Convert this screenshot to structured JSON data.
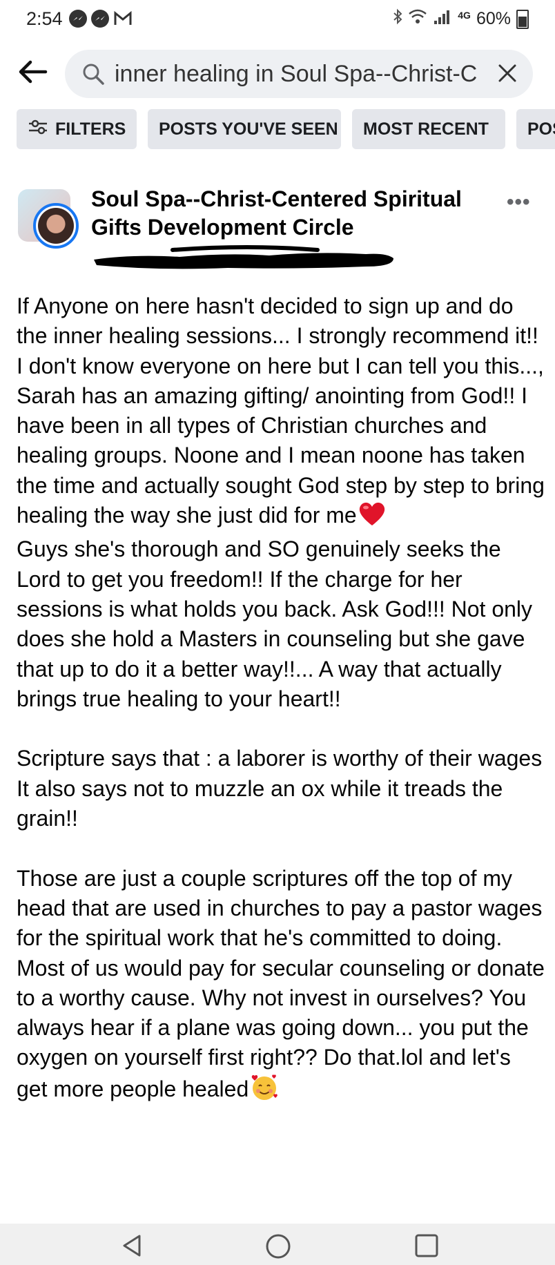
{
  "status_bar": {
    "time": "2:54",
    "notifications": [
      "messenger-icon",
      "messenger-icon",
      "gmail-icon"
    ],
    "network": "4G",
    "battery": "60%",
    "icons": [
      "bluetooth-icon",
      "wifi-icon",
      "signal-icon",
      "battery-icon"
    ]
  },
  "search": {
    "query": "inner healing in Soul Spa--Christ-C",
    "back_icon": "back-arrow-icon",
    "search_icon": "search-icon",
    "clear_icon": "close-icon"
  },
  "filters": {
    "filters_label": "FILTERS",
    "chips": [
      "POSTS YOU'VE SEEN",
      "MOST RECENT",
      "POST"
    ]
  },
  "post": {
    "group_name": "Soul Spa--Christ-Centered Spiritual Gifts Development Circle",
    "paragraphs": [
      "If Anyone on here hasn't decided to sign up and do the inner healing sessions... I strongly recommend it!! I don't know everyone on here but I can tell you this..., Sarah has an amazing gifting/ anointing from God!! I have been in all types of Christian churches and healing  groups.  Noone and I mean noone has taken the time and actually sought God step by step to bring healing the way she just did for me",
      "Guys she's thorough and SO genuinely seeks the Lord to get you freedom!! If the charge for her sessions is what holds you back. Ask God!!! Not only does she hold a Masters in counseling but she gave that up to do it a better way!!... A way that actually brings true healing to your heart!!",
      "Scripture says that : a laborer is worthy of their wages",
      "It also says not to muzzle an ox while it treads the grain!!",
      "Those are just a couple scriptures off the top of my head that are used in churches to pay a pastor wages for the spiritual work that he's committed to doing. Most of us would pay for secular counseling or donate to a worthy cause. Why not invest in ourselves? You always hear if a plane was going down... you put the oxygen on yourself first right?? Do that.lol and let's get more people healed"
    ],
    "emojis": [
      "red-heart-emoji",
      "smiling-face-with-hearts-emoji"
    ],
    "colors": {
      "link_blue": "#1877f2",
      "chip_bg": "#e4e6eb",
      "search_bg": "#eef0f3"
    }
  },
  "nav": {
    "buttons": [
      "back-triangle-icon",
      "home-circle-icon",
      "recents-square-icon"
    ]
  }
}
